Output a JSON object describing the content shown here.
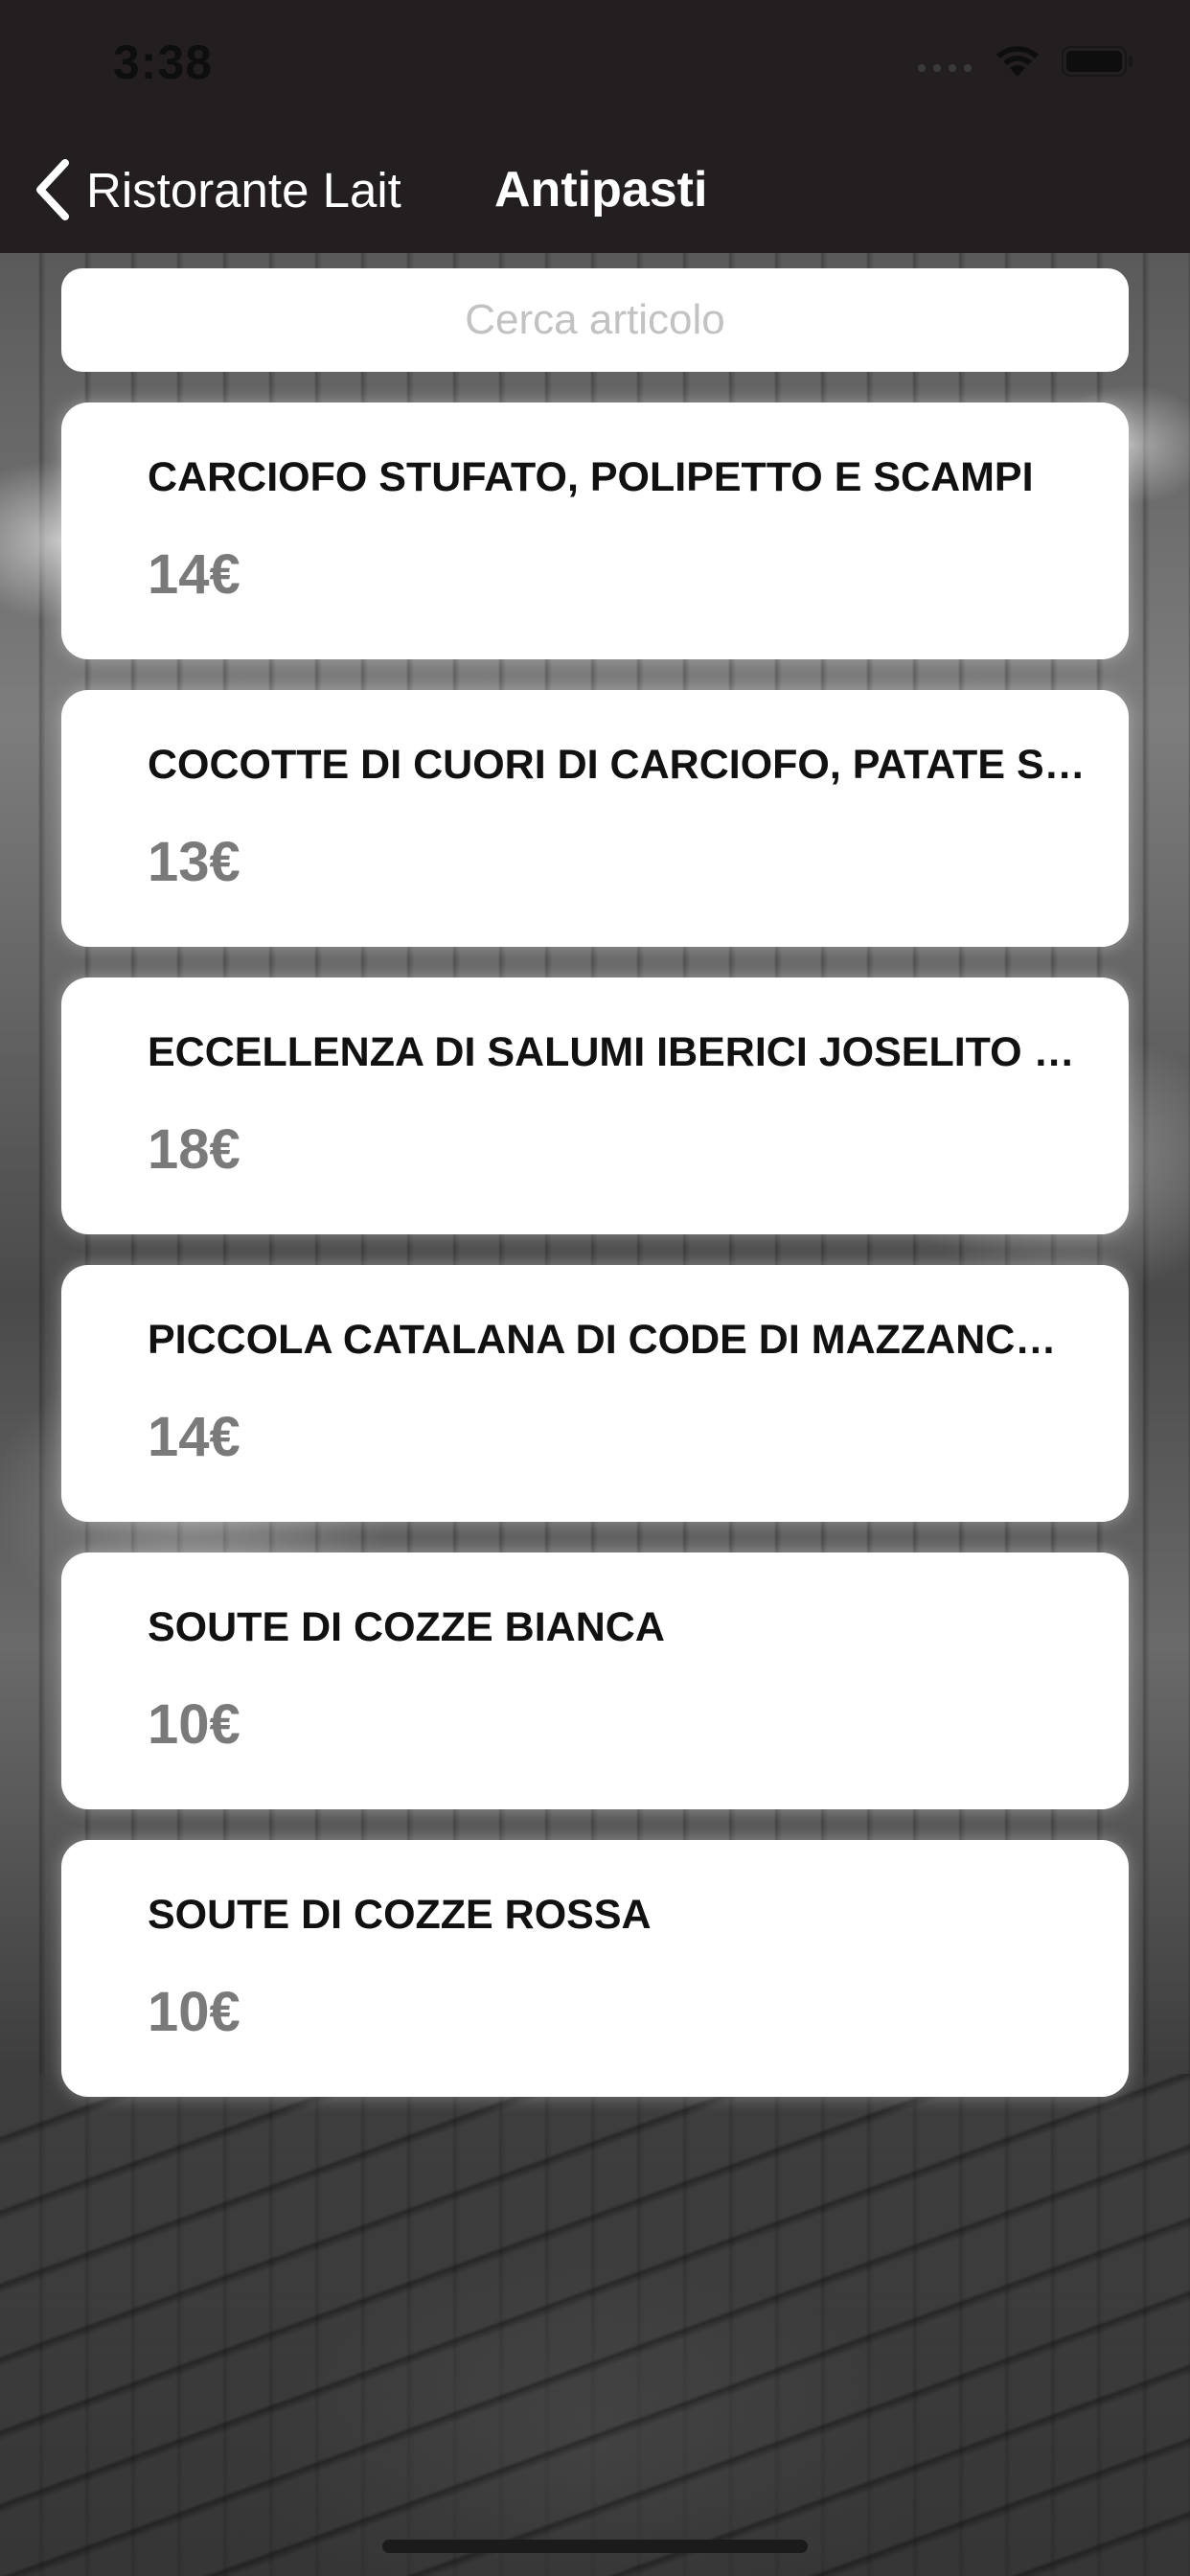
{
  "status_bar": {
    "time": "3:38"
  },
  "nav": {
    "back_label": "Ristorante Lait",
    "title": "Antipasti"
  },
  "search": {
    "placeholder": "Cerca articolo",
    "value": ""
  },
  "items": [
    {
      "name": "CARCIOFO STUFATO, POLIPETTO E SCAMPI",
      "price": "14€"
    },
    {
      "name": "COCOTTE DI CUORI DI CARCIOFO, PATATE SCHIACCIATE",
      "price": "13€"
    },
    {
      "name": "ECCELLENZA DI SALUMI IBERICI JOSELITO E PAN CON TOMATE",
      "price": "18€"
    },
    {
      "name": "PICCOLA CATALANA DI CODE DI MAZZANCOLLE",
      "price": "14€"
    },
    {
      "name": "SOUTE DI COZZE BIANCA",
      "price": "10€"
    },
    {
      "name": "SOUTE DI COZZE ROSSA",
      "price": "10€"
    }
  ],
  "colors": {
    "bar_background": "#231f20",
    "card_background": "#ffffff",
    "price_text": "#7a7a7a"
  },
  "icons": {
    "back": "chevron-left-icon",
    "signal": "signal-icon",
    "wifi": "wifi-icon",
    "battery": "battery-icon"
  }
}
